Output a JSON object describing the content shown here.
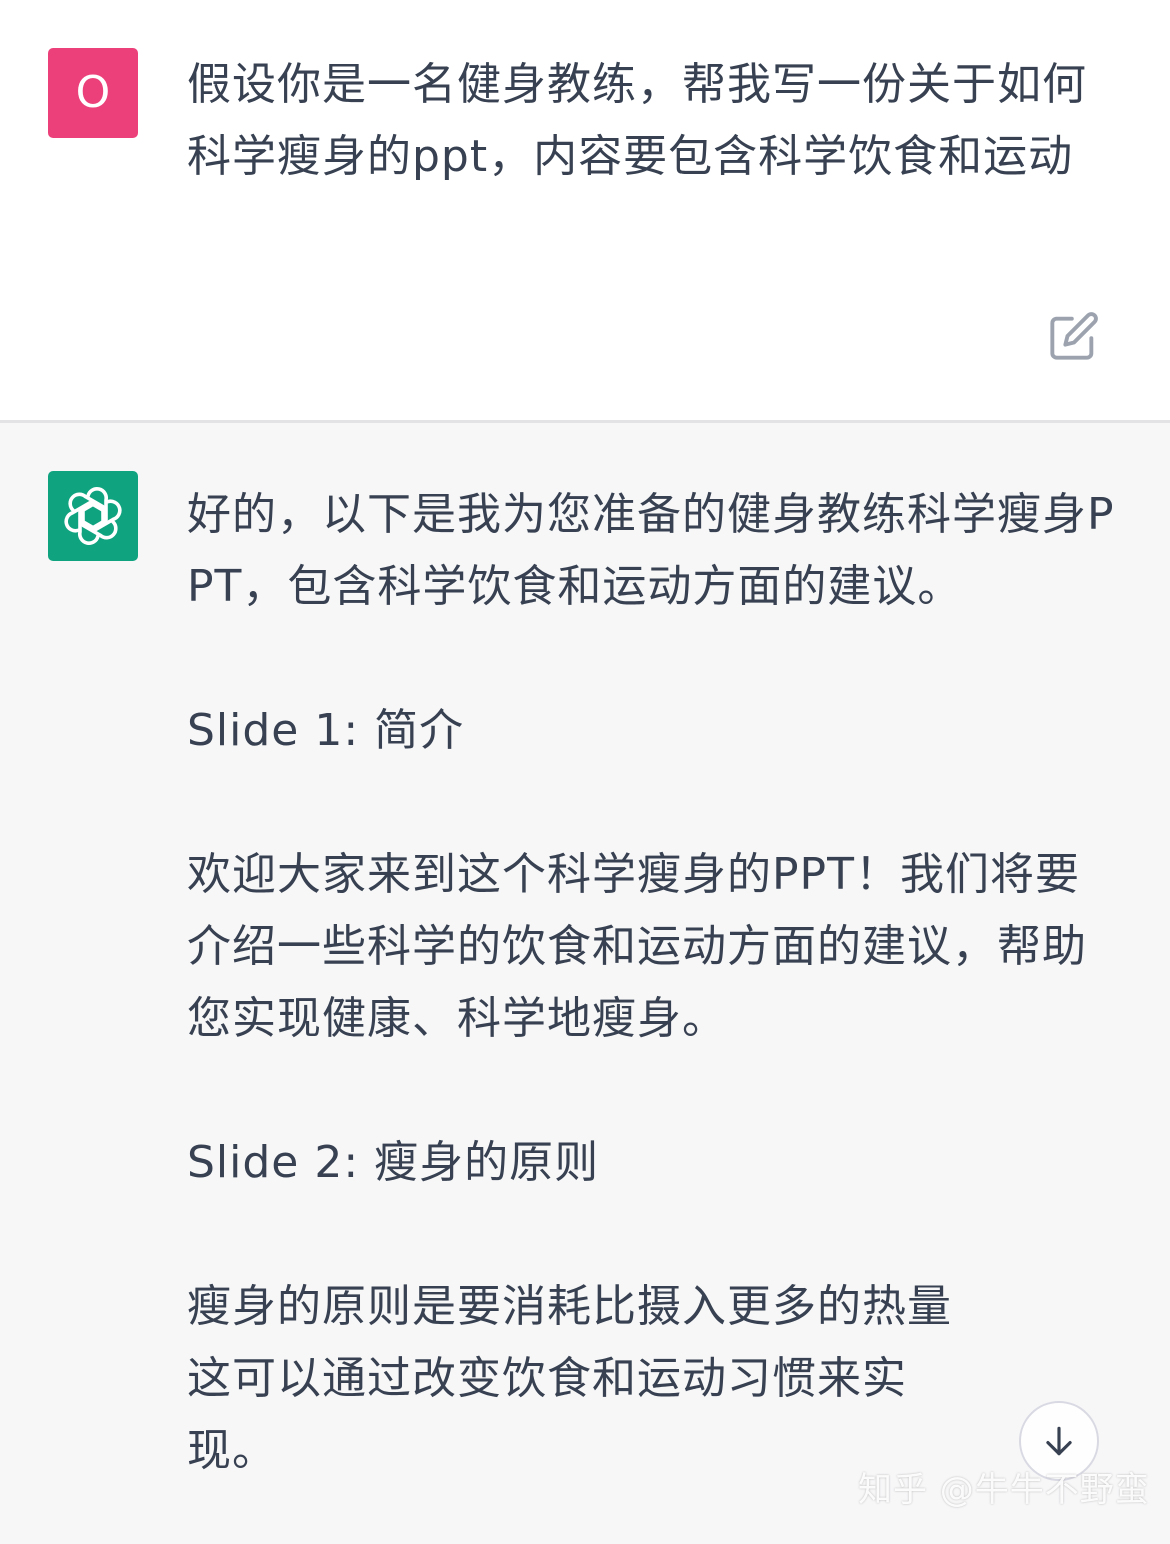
{
  "user_message": {
    "avatar_letter": "O",
    "avatar_color": "#ec407a",
    "text": "假设你是一名健身教练，帮我写一份关于如何科学瘦身的ppt，内容要包含科学饮食和运动"
  },
  "assistant_message": {
    "avatar_icon": "openai-logo-icon",
    "avatar_color": "#10a37f",
    "paragraphs": [
      "好的，以下是我为您准备的健身教练科学瘦身PPT，包含科学饮食和运动方面的建议。",
      "Slide 1: 简介",
      "欢迎大家来到这个科学瘦身的PPT！我们将要介绍一些科学的饮食和运动方面的建议，帮助您实现健康、科学地瘦身。",
      "Slide 2: 瘦身的原则",
      "瘦身的原则是要消耗比摄入更多的热量这可以通过改变饮食和运动习惯来实现。"
    ]
  },
  "icons": {
    "edit": "edit-icon",
    "scroll_down": "arrow-down-icon"
  },
  "watermark": "知乎 @牛牛不野蛮"
}
